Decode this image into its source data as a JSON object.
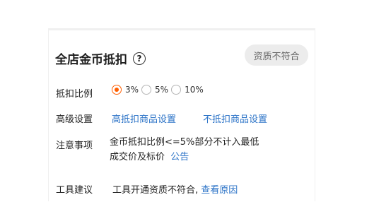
{
  "title": "全店金币抵扣",
  "help_glyph": "?",
  "badge": "资质不符合",
  "ratio": {
    "label": "抵扣比例",
    "options": [
      {
        "label": "3%",
        "checked": true
      },
      {
        "label": "5%",
        "checked": false
      },
      {
        "label": "10%",
        "checked": false
      }
    ]
  },
  "advanced": {
    "label": "高级设置",
    "link1": "高抵扣商品设置",
    "link2": "不抵扣商品设置"
  },
  "notice": {
    "label": "注意事项",
    "line1": "金币抵扣比例<=5%部分不计入最低",
    "line2": "成交价及标价",
    "link": "公告"
  },
  "tool": {
    "label": "工具建议",
    "text": "工具开通资质不符合,",
    "link": "查看原因"
  },
  "colors": {
    "accent": "#ff5e00",
    "link": "#2b73c7",
    "badge_bg": "#ececec"
  }
}
